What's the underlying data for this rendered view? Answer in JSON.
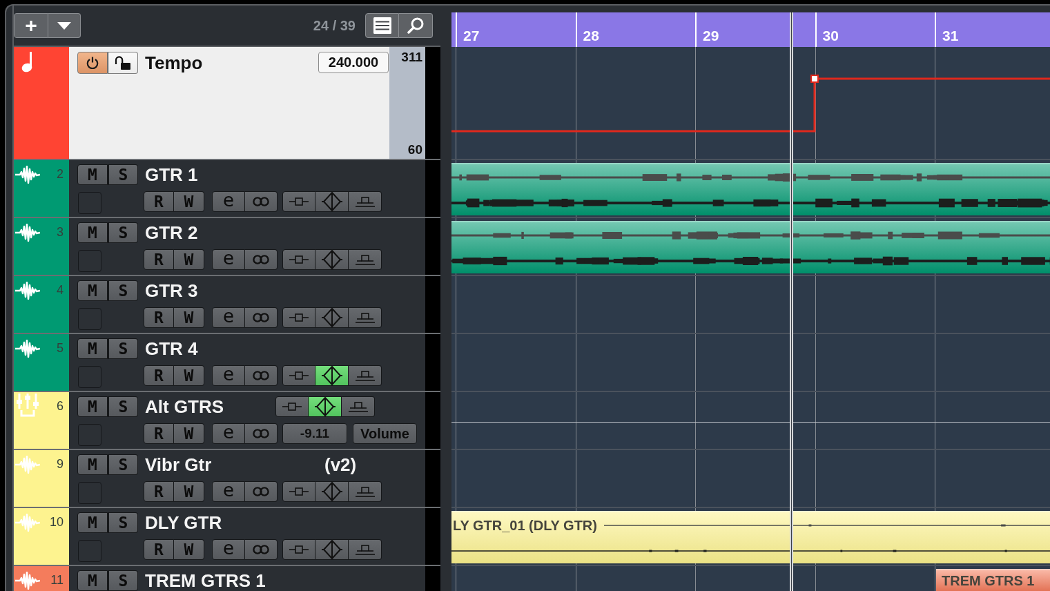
{
  "toolbar": {
    "add_label": "+",
    "track_count": "24 / 39"
  },
  "tempo_track": {
    "name": "Tempo",
    "color": "#ff4433",
    "power_on": true,
    "locked": false,
    "value": "240.000",
    "scale_max": "311",
    "scale_min": "60"
  },
  "tracks": [
    {
      "number": "2",
      "name": "GTR 1",
      "kind": "audio",
      "color": "#009a72",
      "mute_solo": [
        "M",
        "S"
      ],
      "read_write": [
        "R",
        "W"
      ],
      "edit": "e",
      "diamond_on": false,
      "cut_off": false,
      "clip": {
        "starts_in_view": false
      }
    },
    {
      "number": "3",
      "name": "GTR 2",
      "kind": "audio",
      "color": "#009a72",
      "mute_solo": [
        "M",
        "S"
      ],
      "read_write": [
        "R",
        "W"
      ],
      "edit": "e",
      "diamond_on": false,
      "cut_off": false,
      "clip": {
        "starts_in_view": false
      }
    },
    {
      "number": "4",
      "name": "GTR 3",
      "kind": "audio",
      "color": "#009a72",
      "mute_solo": [
        "M",
        "S"
      ],
      "read_write": [
        "R",
        "W"
      ],
      "edit": "e",
      "diamond_on": false,
      "cut_off": false
    },
    {
      "number": "5",
      "name": "GTR 4",
      "kind": "audio",
      "color": "#009a72",
      "mute_solo": [
        "M",
        "S"
      ],
      "read_write": [
        "R",
        "W"
      ],
      "edit": "e",
      "diamond_on": true,
      "cut_off": false
    },
    {
      "number": "6",
      "name": "Alt GTRS",
      "kind": "group",
      "color": "#fdf38f",
      "mute_solo": [
        "M",
        "S"
      ],
      "read_write": [
        "R",
        "W"
      ],
      "edit": "e",
      "diamond_on": true,
      "value": "-9.11",
      "parameter": "Volume",
      "cut_off": false
    },
    {
      "number": "9",
      "name": "Vibr Gtr",
      "kind": "audio",
      "color": "#fdf38f",
      "mute_solo": [
        "M",
        "S"
      ],
      "tag": "(v2)",
      "read_write": [
        "R",
        "W"
      ],
      "edit": "e",
      "diamond_on": false,
      "cut_off": false
    },
    {
      "number": "10",
      "name": "DLY GTR",
      "kind": "audio",
      "color": "#fdf38f",
      "mute_solo": [
        "M",
        "S"
      ],
      "read_write": [
        "R",
        "W"
      ],
      "edit": "e",
      "diamond_on": false,
      "cut_off": false,
      "clip": {
        "label": "LY GTR_01 (DLY GTR)",
        "starts_in_view": false
      }
    },
    {
      "number": "11",
      "name": "TREM GTRS 1",
      "kind": "audio",
      "color": "#f47c5c",
      "mute_solo": [
        "M",
        "S"
      ],
      "cut_off": true,
      "clip": {
        "label": "TREM GTRS 1",
        "starts_in_view": true
      }
    }
  ],
  "timeline": {
    "bars": [
      "27",
      "28",
      "29",
      "30",
      "31"
    ]
  }
}
